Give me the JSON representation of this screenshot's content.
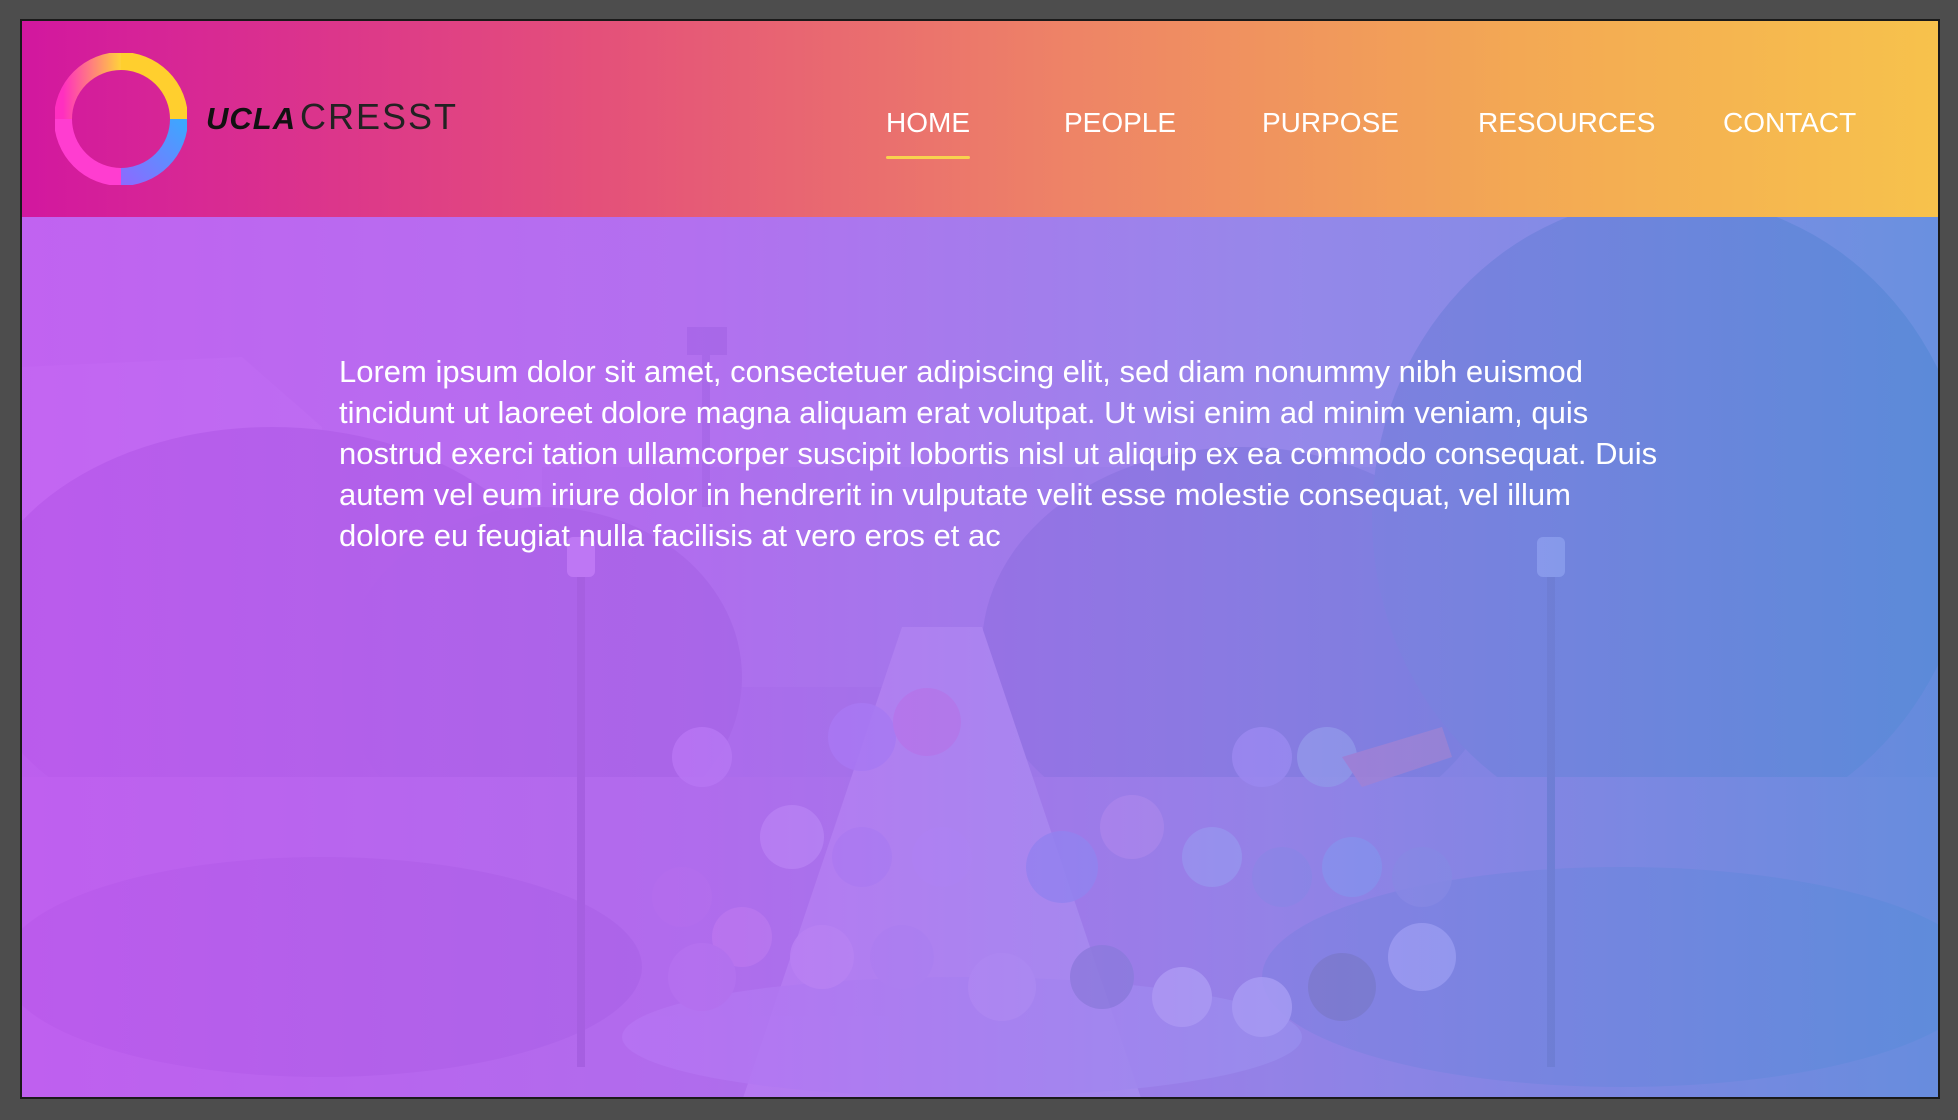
{
  "brand": {
    "logo_ucla": "UCLA",
    "logo_cresst": "CRESST"
  },
  "nav": {
    "items": [
      {
        "label": "HOME",
        "active": true
      },
      {
        "label": "PEOPLE",
        "active": false
      },
      {
        "label": "PURPOSE",
        "active": false
      },
      {
        "label": "RESOURCES",
        "active": false
      },
      {
        "label": "CONTACT",
        "active": false
      }
    ]
  },
  "hero": {
    "paragraph": "Lorem ipsum dolor sit amet, consectetuer adipiscing elit, sed diam nonummy nibh euismod tincidunt ut laoreet dolore magna aliquam erat volutpat. Ut wisi enim ad minim veniam, quis nostrud exerci tation ullamcorper suscipit lobortis nisl ut aliquip ex ea commodo consequat. Duis autem vel eum iriure dolor in hendrerit in vulputate velit esse molestie consequat, vel illum dolore eu feugiat nulla facilisis at vero eros et ac",
    "image": "campus-with-cartoon-characters"
  },
  "colors": {
    "header_start": "#d2179f",
    "header_end": "#f7c24c",
    "nav_active_underline": "#f8d24e",
    "overlay_left": "#c85ff5",
    "overlay_right": "#5f96e1"
  }
}
